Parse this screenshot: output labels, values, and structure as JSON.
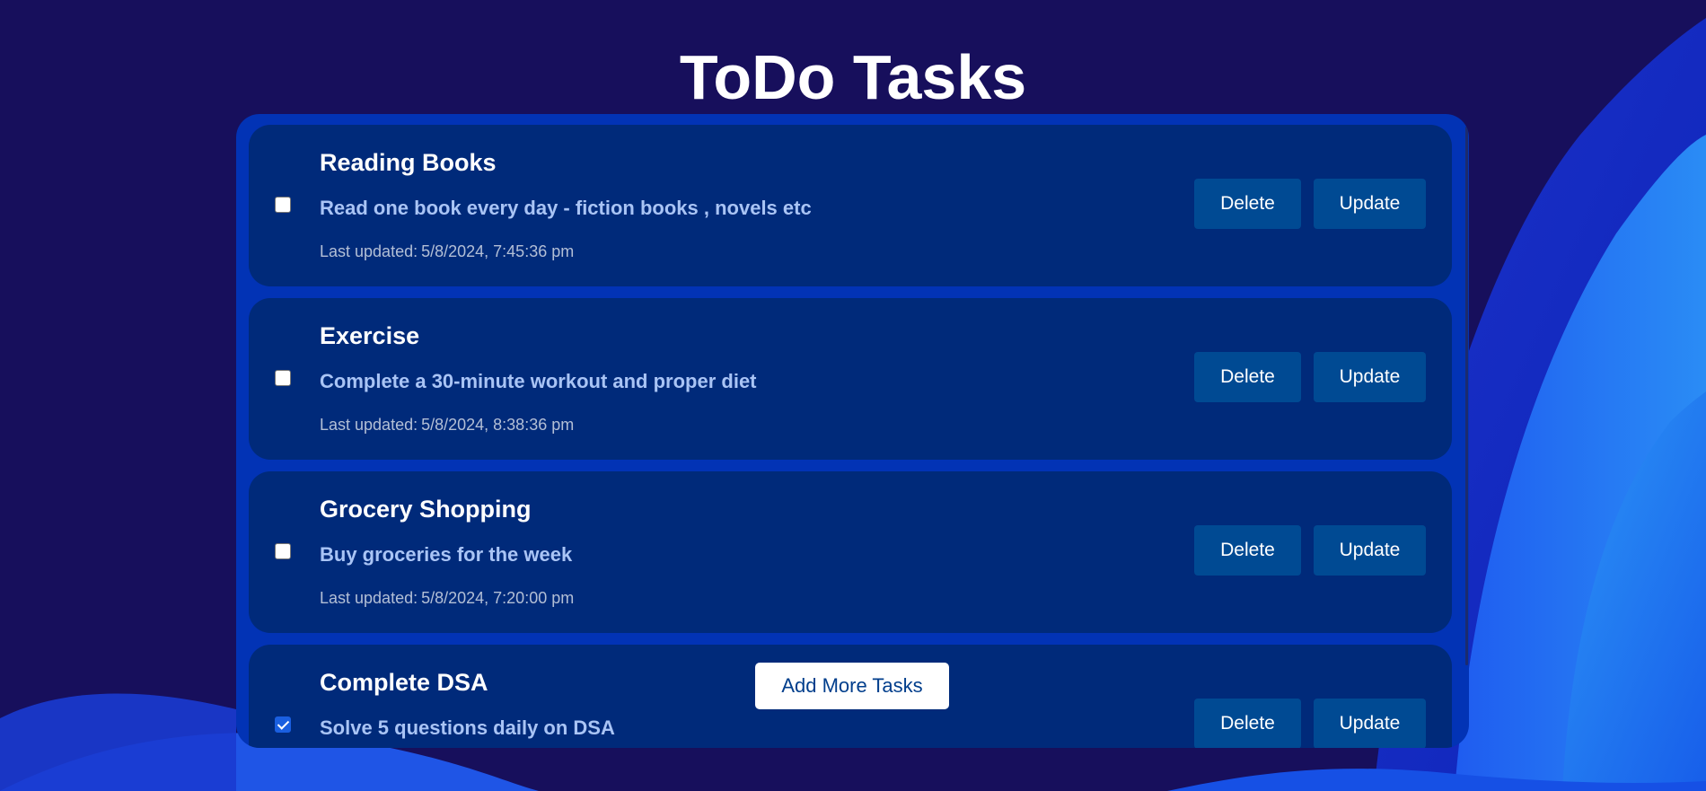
{
  "app": {
    "title": "ToDo Tasks",
    "add_button_label": "Add More Tasks"
  },
  "labels": {
    "delete": "Delete",
    "update": "Update",
    "last_updated": "Last updated:"
  },
  "tasks": [
    {
      "title": "Reading Books",
      "description": "Read one book every day - fiction books , novels etc",
      "last_updated": "5/8/2024, 7:45:36 pm",
      "completed": false
    },
    {
      "title": "Exercise",
      "description": "Complete a 30-minute workout and proper diet",
      "last_updated": "5/8/2024, 8:38:36 pm",
      "completed": false
    },
    {
      "title": "Grocery Shopping",
      "description": "Buy groceries for the week",
      "last_updated": "5/8/2024, 7:20:00 pm",
      "completed": false
    },
    {
      "title": "Complete DSA",
      "description": "Solve 5 questions daily on DSA",
      "last_updated": "",
      "completed": true
    }
  ],
  "colors": {
    "background": "#170f5c",
    "panel": "#0233b5",
    "card": "#002a7a",
    "button": "#004a93",
    "description": "#a9c4f5",
    "add_button_text": "#003e8c"
  }
}
